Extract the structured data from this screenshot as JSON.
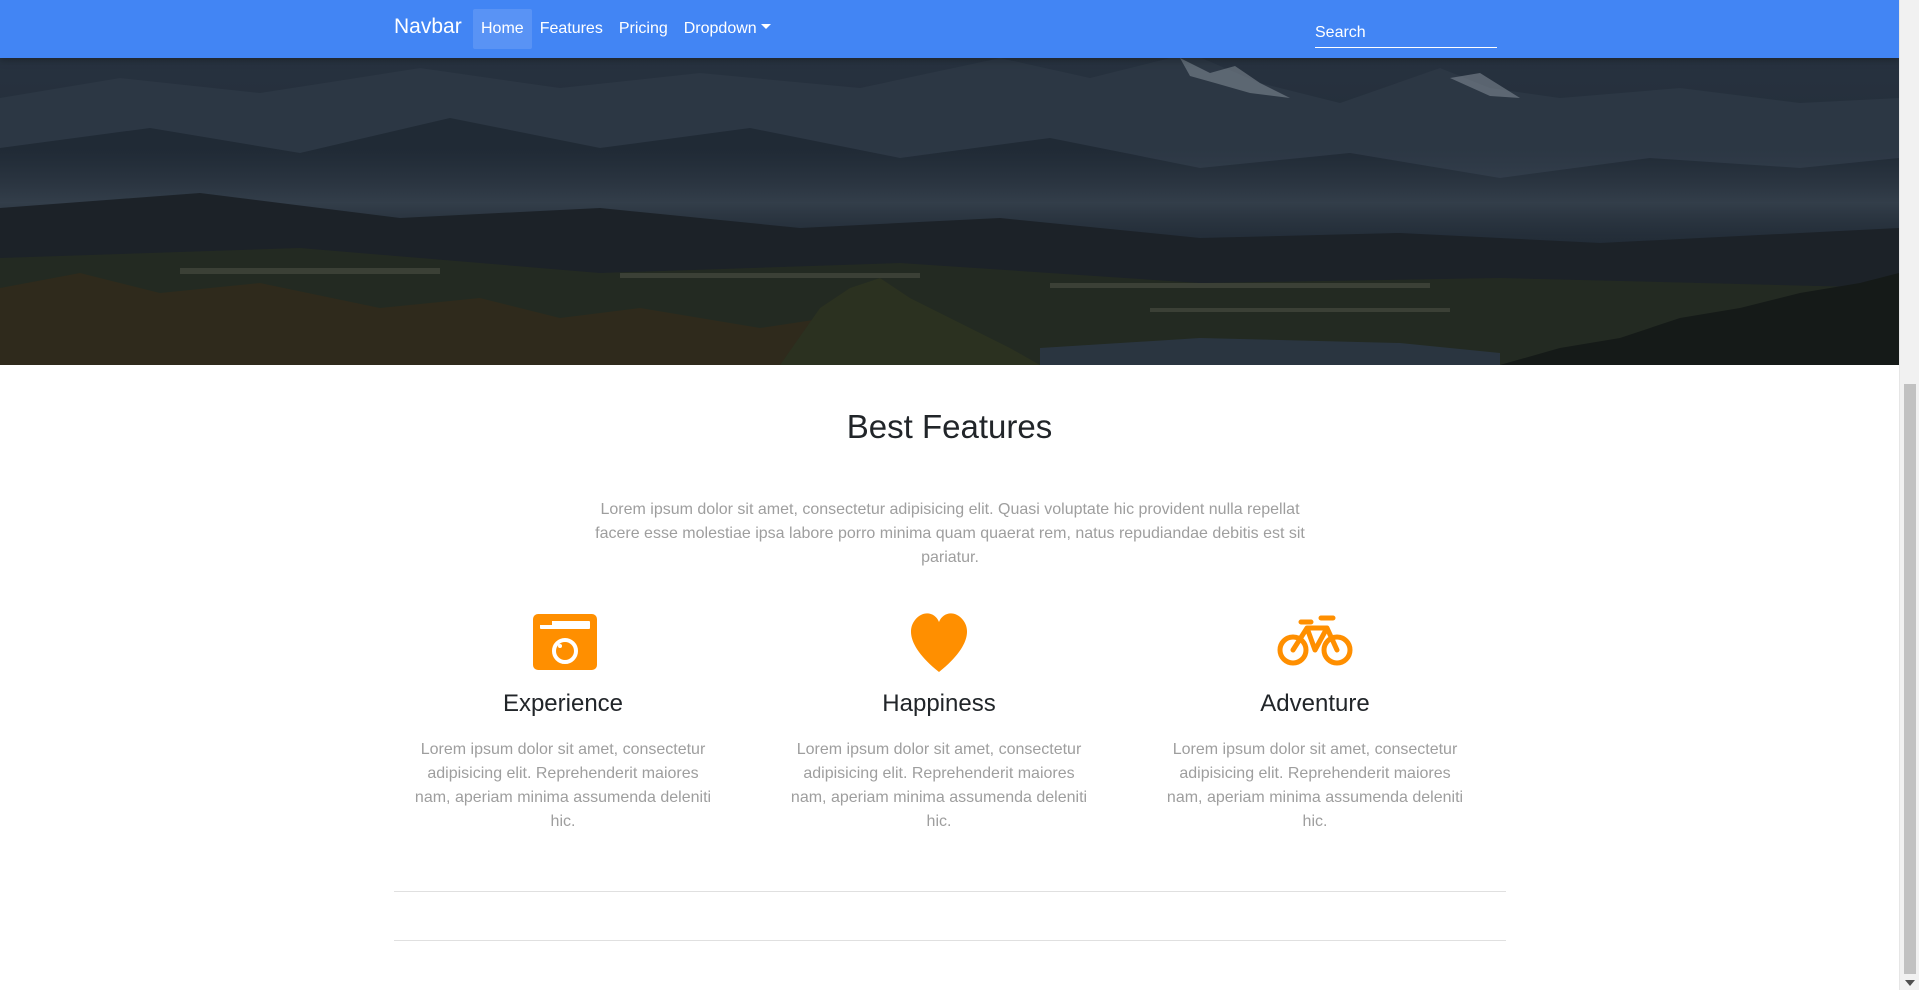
{
  "navbar": {
    "brand": "Navbar",
    "links": [
      {
        "label": "Home",
        "active": true
      },
      {
        "label": "Features"
      },
      {
        "label": "Pricing"
      },
      {
        "label": "Dropdown"
      }
    ],
    "search_placeholder": "Search",
    "color": "#4285f4"
  },
  "features": {
    "title": "Best Features",
    "lead": "Lorem ipsum dolor sit amet, consectetur adipisicing elit. Quasi voluptate hic provident nulla repellat facere esse molestiae ipsa labore porro minima quam quaerat rem, natus repudiandae debitis est sit pariatur.",
    "accent_color": "#ff8f00",
    "items": [
      {
        "icon": "camera-icon",
        "title": "Experience",
        "text": "Lorem ipsum dolor sit amet, consectetur adipisicing elit. Reprehenderit maiores nam, aperiam minima assumenda deleniti hic."
      },
      {
        "icon": "heart-icon",
        "title": "Happiness",
        "text": "Lorem ipsum dolor sit amet, consectetur adipisicing elit. Reprehenderit maiores nam, aperiam minima assumenda deleniti hic."
      },
      {
        "icon": "bicycle-icon",
        "title": "Adventure",
        "text": "Lorem ipsum dolor sit amet, consectetur adipisicing elit. Reprehenderit maiores nam, aperiam minima assumenda deleniti hic."
      }
    ]
  }
}
